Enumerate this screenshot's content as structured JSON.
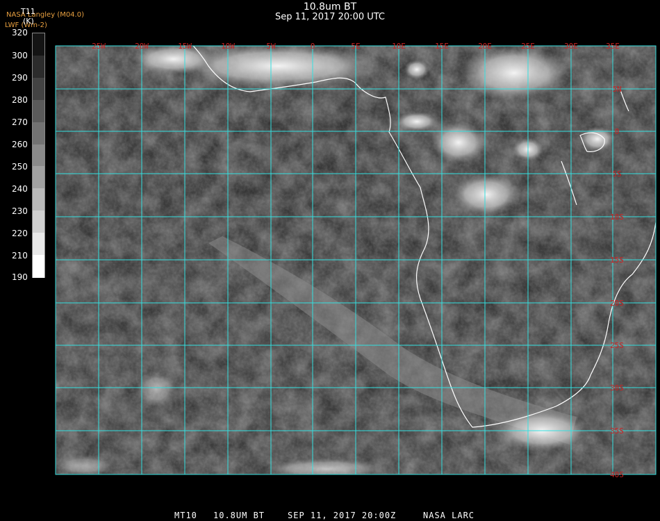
{
  "header": {
    "title": "10.8um BT",
    "subtitle": "Sep 11, 2017 20:00 UTC",
    "source": "NASA Langley (M04.0)",
    "product": "LWF (Wm-2)"
  },
  "colorbar": {
    "title": "T11",
    "unit": "(K)",
    "ticks": [
      "320",
      "300",
      "290",
      "280",
      "270",
      "260",
      "250",
      "240",
      "230",
      "220",
      "210",
      "190"
    ],
    "min_label": "190",
    "max_label": "320"
  },
  "map": {
    "grid_color": "#33e0e0",
    "label_color": "#cc2222",
    "lon_labels": [
      "25W",
      "20W",
      "15W",
      "10W",
      "5W",
      "0",
      "5E",
      "10E",
      "15E",
      "20E",
      "25E",
      "30E",
      "35E"
    ],
    "lat_labels": [
      "5N",
      "0",
      "5S",
      "10S",
      "15S",
      "20S",
      "25S",
      "30S",
      "35S",
      "40S"
    ]
  },
  "footer": {
    "sat": "MT10",
    "channel": "10.8UM BT",
    "date": "SEP 11, 2017 20:00Z",
    "org": "NASA LARC"
  }
}
